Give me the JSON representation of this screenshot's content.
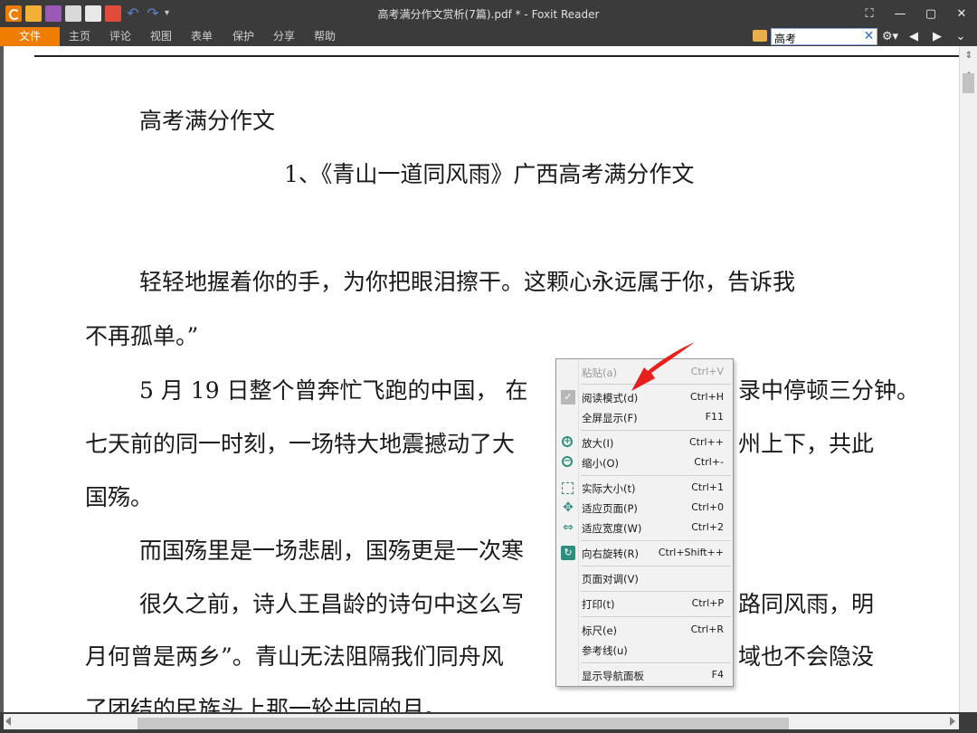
{
  "window": {
    "title": "高考满分作文赏析(7篇).pdf * - Foxit Reader",
    "controls": [
      "⛶",
      "—",
      "▢",
      "✕"
    ]
  },
  "menubar": {
    "tabs": [
      "文件",
      "主页",
      "评论",
      "视图",
      "表单",
      "保护",
      "分享",
      "帮助"
    ]
  },
  "search": {
    "value": "高考",
    "clear_glyph": "✕"
  },
  "toolbar_right": {
    "settings_glyph": "⚙▾",
    "prev_glyph": "◀",
    "next_glyph": "▶",
    "more_glyph": "⌄"
  },
  "document": {
    "lines": [
      "高考满分作文",
      "1、《青山一道同风雨》广西高考满分作文",
      "轻轻地握着你的手，为你把眼泪擦干。这颗心永远属于你，告诉我",
      "不再孤单。”",
      "5 月 19 日整个曾奔忙飞跑的中国，  在",
      "录中停顿三分钟。",
      "七天前的同一时刻，一场特大地震撼动了大",
      "州上下，共此",
      "国殇。",
      "而国殇里是一场悲剧，国殇更是一次寒",
      "很久之前，诗人王昌龄的诗句中这么写",
      "路同风雨，明",
      "月何曾是两乡”。青山无法阻隔我们同舟风",
      "域也不会隐没",
      "了团结的民族头上那一轮共同的月。"
    ]
  },
  "context_menu": {
    "items": [
      {
        "label": "粘贴(a)",
        "shortcut": "Ctrl+V",
        "enabled": false
      },
      {
        "label": "阅读模式(d)",
        "shortcut": "Ctrl+H",
        "checked": true
      },
      {
        "label": "全屏显示(F)",
        "shortcut": "F11"
      },
      {
        "label": "放大(I)",
        "shortcut": "Ctrl++"
      },
      {
        "label": "缩小(O)",
        "shortcut": "Ctrl+-"
      },
      {
        "label": "实际大小(t)",
        "shortcut": "Ctrl+1"
      },
      {
        "label": "适应页面(P)",
        "shortcut": "Ctrl+0"
      },
      {
        "label": "适应宽度(W)",
        "shortcut": "Ctrl+2"
      },
      {
        "label": "向右旋转(R)",
        "shortcut": "Ctrl+Shift++"
      },
      {
        "label": "页面对调(V)",
        "shortcut": ""
      },
      {
        "label": "打印(t)",
        "shortcut": "Ctrl+P"
      },
      {
        "label": "标尺(e)",
        "shortcut": "Ctrl+R"
      },
      {
        "label": "参考线(u)",
        "shortcut": ""
      },
      {
        "label": "显示导航面板",
        "shortcut": "F4"
      }
    ]
  },
  "colors": {
    "accent": "#f07d00",
    "chrome": "#3b3b3b",
    "annotation_arrow": "#e8201c",
    "icon_teal": "#2f8f7f"
  }
}
